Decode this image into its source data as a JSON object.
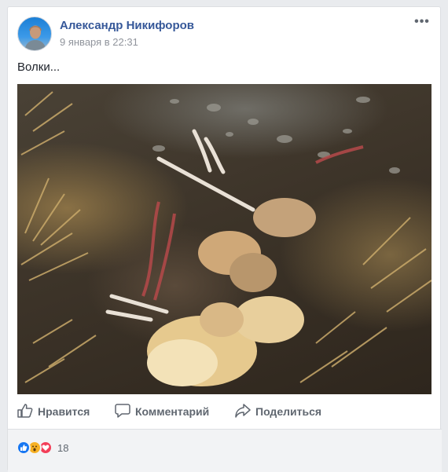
{
  "post": {
    "author": "Александр Никифоров",
    "timestamp": "9 января в 22:31",
    "text": "Волки...",
    "more_label": "•••"
  },
  "photo": {
    "icon": "photo-remains-in-grass"
  },
  "actions": {
    "like_label": "Нравится",
    "comment_label": "Комментарий",
    "share_label": "Поделиться"
  },
  "reactions": {
    "icons": [
      "like-icon",
      "wow-icon",
      "love-icon"
    ],
    "count": "18"
  },
  "colors": {
    "author_link": "#365899",
    "meta_gray": "#90949c",
    "action_gray": "#606770",
    "like_blue": "#1877f2",
    "wow_yellow": "#f7b125",
    "love_red": "#f33e58"
  }
}
